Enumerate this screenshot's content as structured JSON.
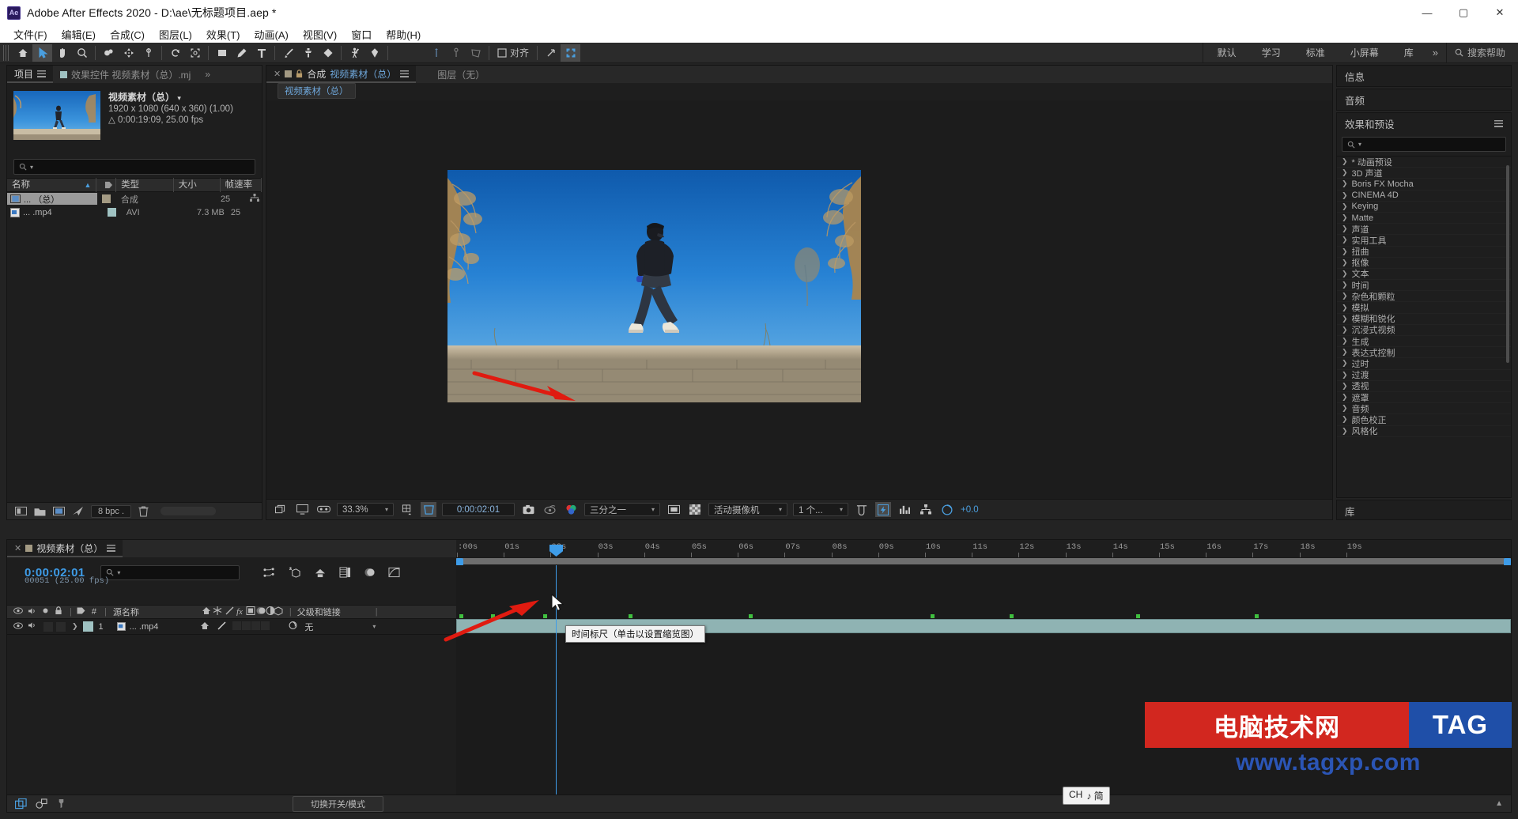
{
  "window": {
    "title": "Adobe After Effects 2020 - D:\\ae\\无标题项目.aep *",
    "logo": "Ae",
    "minimize": "—",
    "maximize": "▢",
    "close": "✕"
  },
  "menu": {
    "items": [
      "文件(F)",
      "编辑(E)",
      "合成(C)",
      "图层(L)",
      "效果(T)",
      "动画(A)",
      "视图(V)",
      "窗口",
      "帮助(H)"
    ]
  },
  "toolbar": {
    "align_label": "对齐",
    "workspaces": [
      "默认",
      "学习",
      "标准",
      "小屏幕",
      "库"
    ],
    "more": "»",
    "search_placeholder": "搜索帮助"
  },
  "project": {
    "tab_project": "项目",
    "tab_effects_controls": "效果控件 视频素材（总）.mj",
    "tab_more": "»",
    "item_name": "视频素材（总）",
    "resolution": "1920 x 1080  (640 x 360) (1.00)",
    "duration": "0:00:19:09, 25.00 fps",
    "search_placeholder": "",
    "columns": [
      "名称",
      "类型",
      "大小",
      "帧速率"
    ],
    "rows": [
      {
        "name": "... （总）",
        "type": "合成",
        "size": "",
        "fps": "25",
        "chip": "#a39a83",
        "selected": true
      },
      {
        "name": "... .mp4",
        "type": "AVI",
        "size": "7.3 MB",
        "fps": "25",
        "chip": "#9fc2c2",
        "selected": false
      }
    ],
    "bpc": "8 bpc"
  },
  "comp": {
    "close_x": "✕",
    "label_comp": "合成",
    "comp_name": "视频素材（总）",
    "tab_layer": "图层（无）",
    "breadcrumb": "视频素材（总）",
    "zoom": "33.3%",
    "time": "0:00:02:01",
    "grid_option": "三分之一",
    "camera": "活动摄像机",
    "views": "1 个...",
    "exposure": "+0.0"
  },
  "right": {
    "info": "信息",
    "audio": "音频",
    "effects_title": "效果和预设",
    "effects_search": "",
    "library": "库",
    "effects": [
      "* 动画预设",
      "3D 声道",
      "Boris FX Mocha",
      "CINEMA 4D",
      "Keying",
      "Matte",
      "声道",
      "实用工具",
      "扭曲",
      "抠像",
      "文本",
      "时间",
      "杂色和颗粒",
      "模拟",
      "模糊和锐化",
      "沉浸式视频",
      "生成",
      "表达式控制",
      "过时",
      "过渡",
      "透视",
      "遮罩",
      "音频",
      "颜色校正",
      "风格化"
    ]
  },
  "timeline": {
    "tab_name": "视频素材（总）",
    "current_time": "0:00:02:01",
    "frame_info": "00051 (25.00 fps)",
    "search_placeholder": "",
    "columns": {
      "source_name": "源名称",
      "number": "#",
      "parent": "父级和链接"
    },
    "layer": {
      "index": "1",
      "name": "... .mp4",
      "parent_value": "无"
    },
    "ruler_labels": [
      ":00s",
      "01s",
      "02s",
      "03s",
      "04s",
      "05s",
      "06s",
      "07s",
      "08s",
      "09s",
      "10s",
      "11s",
      "12s",
      "13s",
      "14s",
      "15s",
      "16s",
      "17s",
      "18s",
      "19s"
    ],
    "tooltip": "时间标尺（单击以设置缩览图）",
    "toggle_label": "切换开关/模式"
  },
  "ch_badge": {
    "text": "CH",
    "note": "♪ 简"
  },
  "watermark": {
    "cn": "电脑技术网",
    "tag": "TAG",
    "url": "www.tagxp.com"
  },
  "colors": {
    "accent_blue": "#3e9ce8",
    "link_blue": "#6fa8dc",
    "panel_bg": "#1e1e1e",
    "chrome": "#2b2b2b",
    "clip_teal": "#8fb3b3",
    "arrow_red": "#e01b10"
  }
}
